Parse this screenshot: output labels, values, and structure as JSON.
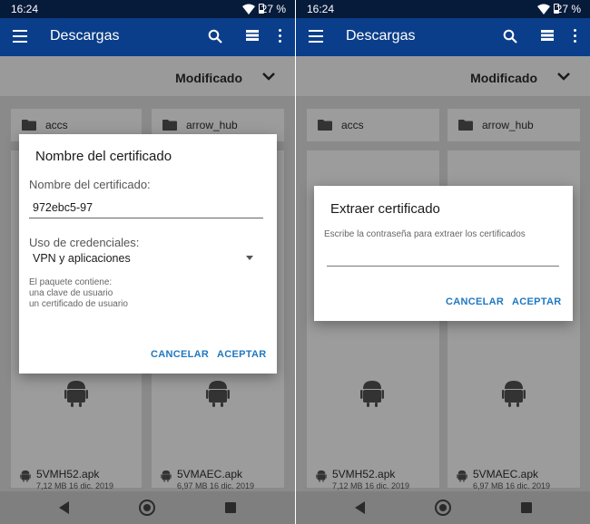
{
  "status_bar": {
    "time": "16:24",
    "battery": "27 %"
  },
  "app_bar": {
    "title": "Descargas"
  },
  "sort": {
    "label": "Modificado"
  },
  "folders": [
    {
      "name": "accs"
    },
    {
      "name": "arrow_hub"
    }
  ],
  "apks": [
    {
      "name": "5VMH52.apk",
      "meta": "7,12 MB 16 dic. 2019"
    },
    {
      "name": "5VMAEC.apk",
      "meta": "6,97 MB 16 dic. 2019"
    }
  ],
  "dialog_left": {
    "title": "Nombre del certificado",
    "name_label": "Nombre del certificado:",
    "name_value": "972ebc5-97",
    "usage_label": "Uso de credenciales:",
    "usage_value": "VPN y aplicaciones",
    "package_contains": "El paquete contiene:",
    "item1": "una clave de usuario",
    "item2": "un certificado de usuario",
    "cancel": "CANCELAR",
    "accept": "ACEPTAR"
  },
  "dialog_right": {
    "title": "Extraer certificado",
    "hint": "Escribe la contraseña para extraer los certificados",
    "cancel": "CANCELAR",
    "accept": "ACEPTAR"
  },
  "colors": {
    "app_bar": "#0b3e8a",
    "status_bar": "#061a3a",
    "accent": "#1f78c1"
  },
  "icons": {
    "status": [
      "wifi-icon",
      "battery-icon"
    ],
    "app_bar": [
      "menu-icon",
      "search-icon",
      "list-view-icon",
      "more-options-icon"
    ],
    "content": [
      "folder-icon",
      "android-icon",
      "chevron-down-icon"
    ],
    "nav": [
      "back-icon",
      "home-icon",
      "recents-icon"
    ]
  }
}
